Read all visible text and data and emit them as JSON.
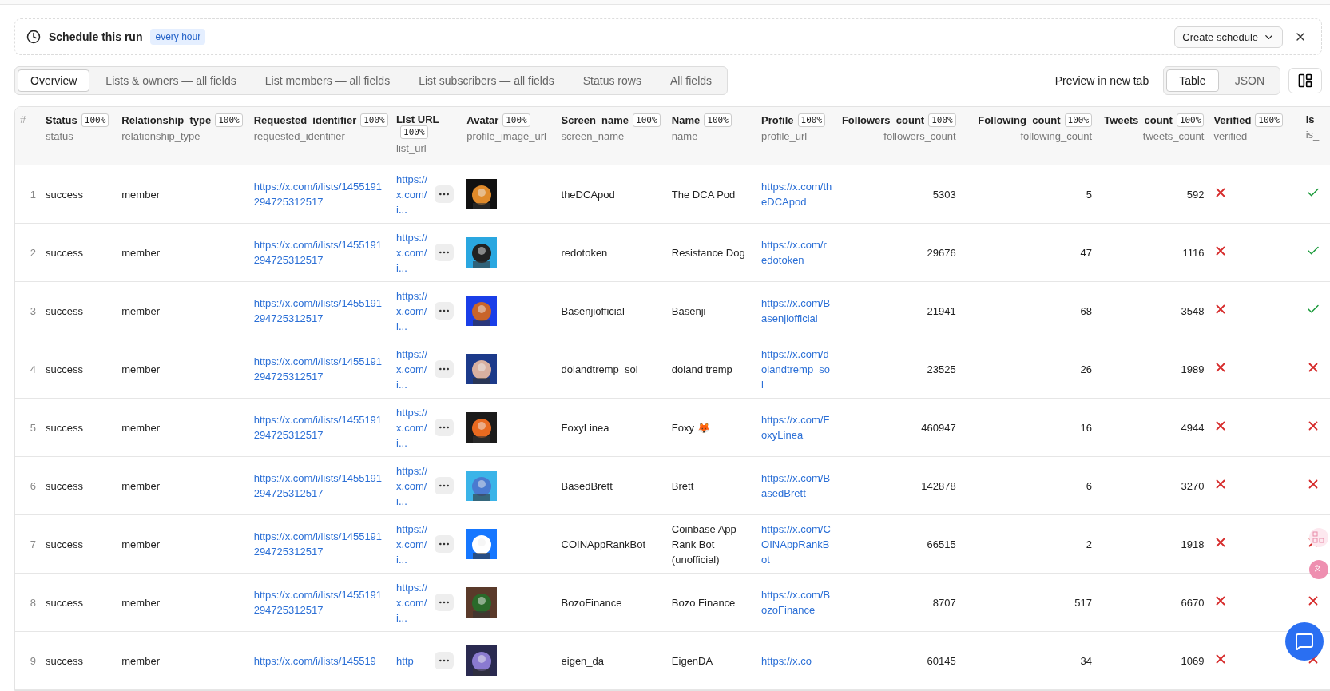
{
  "schedule": {
    "title": "Schedule this run",
    "badge": "every hour",
    "button": "Create schedule"
  },
  "tabs": [
    {
      "label": "Overview",
      "selected": true
    },
    {
      "label": "Lists & owners — all fields",
      "selected": false
    },
    {
      "label": "List members — all fields",
      "selected": false
    },
    {
      "label": "List subscribers — all fields",
      "selected": false
    },
    {
      "label": "Status rows",
      "selected": false
    },
    {
      "label": "All fields",
      "selected": false
    }
  ],
  "preview_link": "Preview in new tab",
  "view_toggle": [
    {
      "label": "Table",
      "selected": true
    },
    {
      "label": "JSON",
      "selected": false
    }
  ],
  "table": {
    "index_header": "#",
    "columns": [
      {
        "title": "Status",
        "badge": "100%",
        "field": "status",
        "kind": "text"
      },
      {
        "title": "Relationship_type",
        "badge": "100%",
        "field": "relationship_type",
        "kind": "text"
      },
      {
        "title": "Requested_identifier",
        "badge": "100%",
        "field": "requested_identifier",
        "kind": "link"
      },
      {
        "title": "List URL",
        "badge": "100%",
        "field": "list_url",
        "kind": "linkmore"
      },
      {
        "title": "Avatar",
        "badge": "100%",
        "field": "profile_image_url"
      },
      {
        "title": "Screen_name",
        "badge": "100%",
        "field": "screen_name",
        "kind": "text"
      },
      {
        "title": "Name",
        "badge": "100%",
        "field": "name",
        "kind": "text"
      },
      {
        "title": "Profile",
        "badge": "100%",
        "field": "profile_url",
        "kind": "link"
      },
      {
        "title": "Followers_count",
        "badge": "100%",
        "field": "followers_count",
        "kind": "number"
      },
      {
        "title": "Following_count",
        "badge": "100%",
        "field": "following_count",
        "kind": "number"
      },
      {
        "title": "Tweets_count",
        "badge": "100%",
        "field": "tweets_count",
        "kind": "number"
      },
      {
        "title": "Verified",
        "badge": "100%",
        "field": "verified",
        "kind": "bool"
      },
      {
        "title": "Is",
        "field": "is_",
        "kind": "bool"
      }
    ],
    "rows": [
      {
        "index": "1",
        "cells": [
          "success",
          "member",
          "https://x.com/i/lists/1455191294725312517",
          "https://x.com/i...",
          {
            "kind": "picture"
          },
          "theDCApod",
          "The DCA Pod",
          "https://x.com/theDCApod",
          "5303",
          "5",
          "592",
          false,
          true
        ]
      },
      {
        "index": "2",
        "cells": [
          "success",
          "member",
          "https://x.com/i/lists/1455191294725312517",
          "https://x.com/i...",
          {
            "kind": "picture"
          },
          "redotoken",
          "Resistance Dog",
          "https://x.com/redotoken",
          "29676",
          "47",
          "1116",
          false,
          true
        ]
      },
      {
        "index": "3",
        "cells": [
          "success",
          "member",
          "https://x.com/i/lists/1455191294725312517",
          "https://x.com/i...",
          {
            "kind": "picture"
          },
          "Basenjiofficial",
          "Basenji",
          "https://x.com/Basenjiofficial",
          "21941",
          "68",
          "3548",
          false,
          true
        ]
      },
      {
        "index": "4",
        "cells": [
          "success",
          "member",
          "https://x.com/i/lists/1455191294725312517",
          "https://x.com/i...",
          {
            "kind": "picture"
          },
          "dolandtremp_sol",
          "doland tremp",
          "https://x.com/dolandtremp_sol",
          "23525",
          "26",
          "1989",
          false,
          false
        ]
      },
      {
        "index": "5",
        "cells": [
          "success",
          "member",
          "https://x.com/i/lists/1455191294725312517",
          "https://x.com/i...",
          {
            "kind": "picture"
          },
          "FoxyLinea",
          "Foxy 🦊",
          "https://x.com/FoxyLinea",
          "460947",
          "16",
          "4944",
          false,
          false
        ]
      },
      {
        "index": "6",
        "cells": [
          "success",
          "member",
          "https://x.com/i/lists/1455191294725312517",
          "https://x.com/i...",
          {
            "kind": "picture"
          },
          "BasedBrett",
          "Brett",
          "https://x.com/BasedBrett",
          "142878",
          "6",
          "3270",
          false,
          false
        ]
      },
      {
        "index": "7",
        "cells": [
          "success",
          "member",
          "https://x.com/i/lists/1455191294725312517",
          "https://x.com/i...",
          {
            "kind": "picture"
          },
          "COINAppRankBot",
          "Coinbase App Rank Bot (unofficial)",
          "https://x.com/COINAppRankBot",
          "66515",
          "2",
          "1918",
          false,
          false
        ]
      },
      {
        "index": "8",
        "cells": [
          "success",
          "member",
          "https://x.com/i/lists/1455191294725312517",
          "https://x.com/i...",
          {
            "kind": "picture"
          },
          "BozoFinance",
          "Bozo Finance",
          "https://x.com/BozoFinance",
          "8707",
          "517",
          "6670",
          false,
          false
        ]
      },
      {
        "index": "9",
        "cells": [
          "success",
          "member",
          "https://x.com/i/lists/145519",
          "http",
          {
            "kind": "picture"
          },
          "eigen_da",
          "EigenDA",
          "https://x.co",
          "60145",
          "34",
          "1069",
          false,
          false
        ]
      }
    ]
  }
}
